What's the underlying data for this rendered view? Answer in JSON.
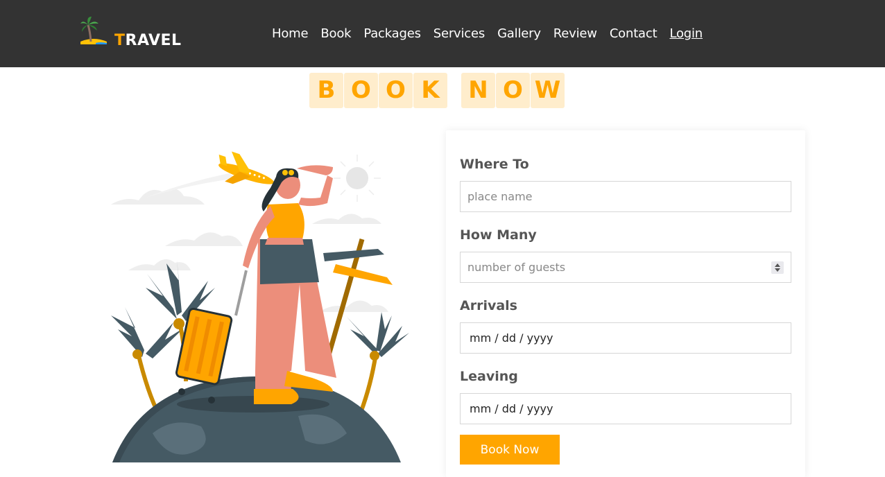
{
  "brand": {
    "first_letter": "T",
    "rest": "RAVEL",
    "logo_icon": "palm-island-icon"
  },
  "nav": {
    "items": [
      "Home",
      "Book",
      "Packages",
      "Services",
      "Gallery",
      "Review",
      "Contact"
    ],
    "login": "Login"
  },
  "heading": {
    "letters": [
      "B",
      "O",
      "O",
      "K",
      "N",
      "O",
      "W"
    ]
  },
  "illustration": {
    "name": "traveler-illustration"
  },
  "form": {
    "where_label": "Where To",
    "where_placeholder": "place name",
    "guests_label": "How Many",
    "guests_placeholder": "number of guests",
    "arrivals_label": "Arrivals",
    "arrivals_value": "mm / dd / yyyy",
    "leaving_label": "Leaving",
    "leaving_value": "mm / dd / yyyy",
    "submit_label": "Book Now"
  },
  "colors": {
    "accent": "#ffa500",
    "header_bg": "#333333",
    "letter_bg": "#ffedcc",
    "label": "#555555"
  }
}
